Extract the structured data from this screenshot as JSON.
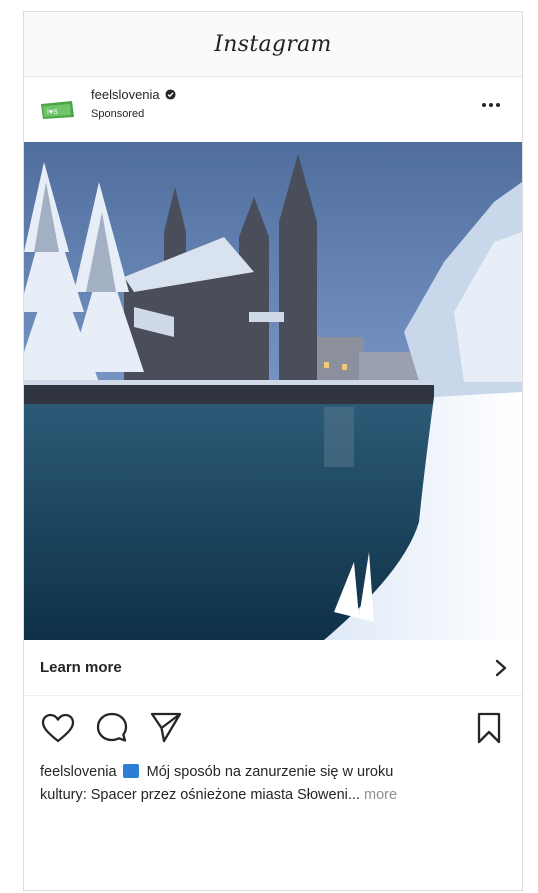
{
  "app": {
    "title": "Instagram"
  },
  "post": {
    "username": "feelslovenia",
    "sponsored_label": "Sponsored",
    "cta_label": "Learn more",
    "caption": {
      "username": "feelslovenia",
      "line1": "Mój sposób na zanurzenie się w uroku",
      "line2": "kultury: Spacer przez ośnieżone miasta Słoweni...",
      "more_label": "more"
    }
  },
  "icons": {
    "avatar": "feelslovenia-logo",
    "verified": "verified-badge-icon",
    "more": "more-options-icon",
    "cta": "chevron-right-icon",
    "like": "heart-icon",
    "comment": "comment-icon",
    "share": "paper-plane-icon",
    "save": "bookmark-icon",
    "emoji": "flag-emoji"
  },
  "colors": {
    "text": "#262626",
    "muted": "#8e8e8e",
    "brand_green": "#4aa546",
    "border": "#dcdcdc"
  }
}
